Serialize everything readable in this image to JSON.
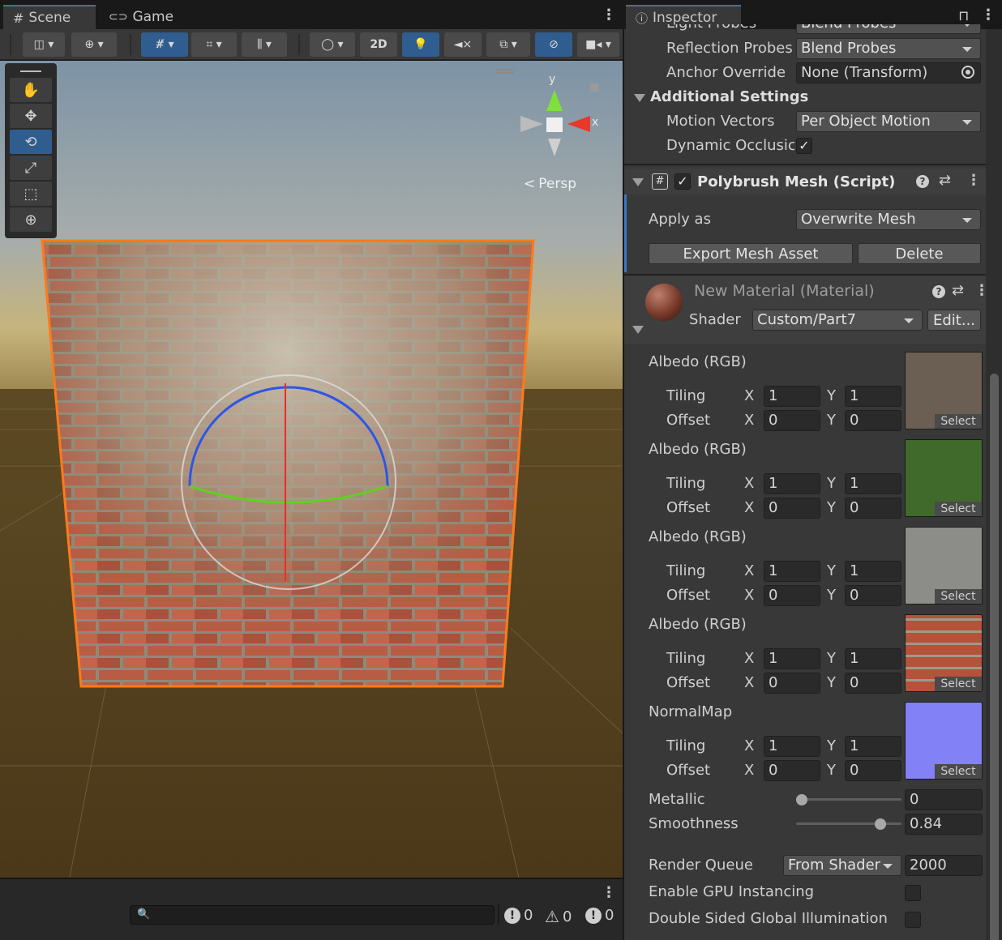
{
  "scene_tabs": {
    "scene_label": "Scene",
    "game_label": "Game"
  },
  "scene_toolbar": {
    "mode_2d_label": "2D"
  },
  "viewport": {
    "projection_label": "Persp",
    "gizmo_y": "y",
    "gizmo_x": "x"
  },
  "console_bar": {
    "search_placeholder": "",
    "info_count": "0",
    "warning_count": "0",
    "error_count": "0"
  },
  "inspector": {
    "tab_label": "Inspector",
    "clipped_top_label": "Light Probes",
    "clipped_top_value": "Blend Probes",
    "reflection_probes": {
      "label": "Reflection Probes",
      "value": "Blend Probes"
    },
    "anchor_override": {
      "label": "Anchor Override",
      "value": "None (Transform)"
    },
    "additional_settings": {
      "label": "Additional Settings"
    },
    "motion_vectors": {
      "label": "Motion Vectors",
      "value": "Per Object Motion"
    },
    "dynamic_occlusion": {
      "label": "Dynamic Occlusic",
      "checked": true
    },
    "polybrush": {
      "title": "Polybrush Mesh (Script)",
      "apply_as_label": "Apply as",
      "apply_as_value": "Overwrite Mesh",
      "export_button": "Export Mesh Asset",
      "delete_button": "Delete"
    },
    "material": {
      "title": "New Material (Material)",
      "shader_label": "Shader",
      "shader_value": "Custom/Part7",
      "edit_button": "Edit..."
    },
    "textures": [
      {
        "label": "Albedo (RGB)",
        "tiling_label": "Tiling",
        "offset_label": "Offset",
        "x_label": "X",
        "y_label": "Y",
        "tiling_x": "1",
        "tiling_y": "1",
        "offset_x": "0",
        "offset_y": "0",
        "select_label": "Select",
        "thumb_color": "#6a5f52"
      },
      {
        "label": "Albedo (RGB)",
        "tiling_label": "Tiling",
        "offset_label": "Offset",
        "x_label": "X",
        "y_label": "Y",
        "tiling_x": "1",
        "tiling_y": "1",
        "offset_x": "0",
        "offset_y": "0",
        "select_label": "Select",
        "thumb_color": "#3f6a2c"
      },
      {
        "label": "Albedo (RGB)",
        "tiling_label": "Tiling",
        "offset_label": "Offset",
        "x_label": "X",
        "y_label": "Y",
        "tiling_x": "1",
        "tiling_y": "1",
        "offset_x": "0",
        "offset_y": "0",
        "select_label": "Select",
        "thumb_color": "#8c8c88"
      },
      {
        "label": "Albedo (RGB)",
        "tiling_label": "Tiling",
        "offset_label": "Offset",
        "x_label": "X",
        "y_label": "Y",
        "tiling_x": "1",
        "tiling_y": "1",
        "offset_x": "0",
        "offset_y": "0",
        "select_label": "Select",
        "thumb_color": "#b4523a"
      },
      {
        "label": "NormalMap",
        "tiling_label": "Tiling",
        "offset_label": "Offset",
        "x_label": "X",
        "y_label": "Y",
        "tiling_x": "1",
        "tiling_y": "1",
        "offset_x": "0",
        "offset_y": "0",
        "select_label": "Select",
        "thumb_color": "#8281f5"
      }
    ],
    "metallic": {
      "label": "Metallic",
      "value": "0",
      "fraction": 0.0
    },
    "smoothness": {
      "label": "Smoothness",
      "value": "0.84",
      "fraction": 0.84
    },
    "render_queue": {
      "label": "Render Queue",
      "mode": "From Shader",
      "value": "2000"
    },
    "gpu_instancing": {
      "label": "Enable GPU Instancing",
      "checked": false
    },
    "double_sided_gi": {
      "label": "Double Sided Global Illumination",
      "checked": false
    }
  },
  "colors": {
    "accent_blue": "#2f5d8f",
    "selection_outline": "#ff7a1a"
  }
}
